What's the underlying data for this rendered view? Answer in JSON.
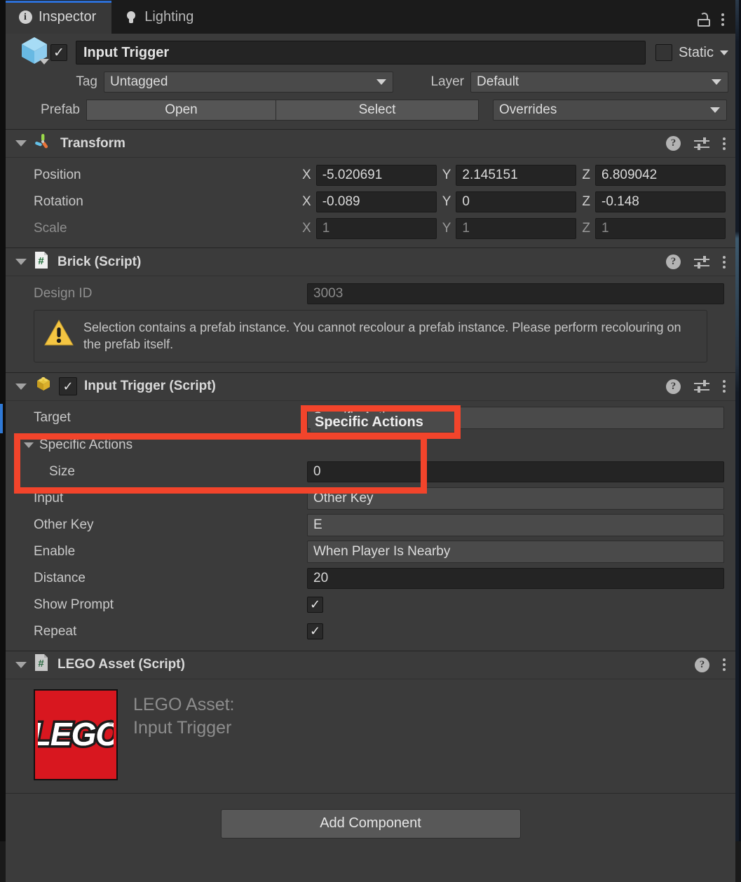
{
  "window": {
    "tabs": [
      {
        "label": "Inspector",
        "icon": "info-icon",
        "active": true
      },
      {
        "label": "Lighting",
        "icon": "lightbulb-icon",
        "active": false
      }
    ],
    "lock_icon": "lock-icon",
    "menu_icon": "kebab-menu-icon",
    "accent_color": "#2c6fd6"
  },
  "object_header": {
    "enabled": true,
    "name": "Input Trigger",
    "static_label": "Static",
    "static_checked": false,
    "tag_label": "Tag",
    "tag_value": "Untagged",
    "layer_label": "Layer",
    "layer_value": "Default",
    "prefab_label": "Prefab",
    "prefab_open": "Open",
    "prefab_select": "Select",
    "prefab_overrides": "Overrides"
  },
  "components": [
    {
      "title": "Transform",
      "icon": "transform-gizmo-icon",
      "has_checkbox": false,
      "help_icon": "help-icon",
      "preset_icon": "preset-sliders-icon",
      "menu_icon": "kebab-menu-icon",
      "rows": [
        {
          "type": "vector3",
          "label": "Position",
          "dim": false,
          "axes": [
            "X",
            "Y",
            "Z"
          ],
          "values": [
            "-5.020691",
            "2.145151",
            "6.809042"
          ]
        },
        {
          "type": "vector3",
          "label": "Rotation",
          "dim": false,
          "axes": [
            "X",
            "Y",
            "Z"
          ],
          "values": [
            "-0.089",
            "0",
            "-0.148"
          ]
        },
        {
          "type": "vector3",
          "label": "Scale",
          "dim": true,
          "axes": [
            "X",
            "Y",
            "Z"
          ],
          "values": [
            "1",
            "1",
            "1"
          ]
        }
      ]
    },
    {
      "title": "Brick (Script)",
      "icon": "csharp-script-icon",
      "has_checkbox": false,
      "help_icon": "help-icon",
      "preset_icon": "preset-sliders-icon",
      "menu_icon": "kebab-menu-icon",
      "rows": [
        {
          "type": "text",
          "label": "Design ID",
          "dim": true,
          "value": "3003"
        },
        {
          "type": "warning",
          "icon": "warning-triangle-icon",
          "text": "Selection contains a prefab instance. You cannot recolour a prefab instance. Please perform recolouring on the prefab itself."
        }
      ]
    },
    {
      "title": "Input Trigger (Script)",
      "icon": "lego-brick-icon",
      "has_checkbox": true,
      "checked": true,
      "help_icon": "help-icon",
      "preset_icon": "preset-sliders-icon",
      "menu_icon": "kebab-menu-icon",
      "rows": [
        {
          "type": "dropdown",
          "label": "Target",
          "value": "Specific Actions",
          "modified": true
        },
        {
          "type": "foldout",
          "label": "Specific Actions",
          "expanded": true
        },
        {
          "type": "number",
          "label": "Size",
          "value": "0",
          "indent": 2
        },
        {
          "type": "dropdown",
          "label": "Input",
          "value": "Other Key"
        },
        {
          "type": "dropdown",
          "label": "Other Key",
          "value": "E"
        },
        {
          "type": "dropdown",
          "label": "Enable",
          "value": "When Player Is Nearby"
        },
        {
          "type": "number",
          "label": "Distance",
          "value": "20"
        },
        {
          "type": "checkbox",
          "label": "Show Prompt",
          "checked": true
        },
        {
          "type": "checkbox",
          "label": "Repeat",
          "checked": true
        }
      ]
    },
    {
      "title": "LEGO Asset (Script)",
      "icon": "csharp-script-icon",
      "has_checkbox": false,
      "help_icon": "help-icon",
      "menu_icon": "kebab-menu-icon",
      "asset": {
        "logo_icon": "lego-logo-icon",
        "logo_text": "LEGO",
        "line1": "LEGO Asset:",
        "line2": "Input Trigger"
      }
    }
  ],
  "footer": {
    "add_component_label": "Add Component"
  },
  "annotations": {
    "highlight_color": "#f2442b",
    "boxes": [
      {
        "name": "target-value-highlight"
      },
      {
        "name": "specific-actions-size-highlight"
      }
    ]
  }
}
